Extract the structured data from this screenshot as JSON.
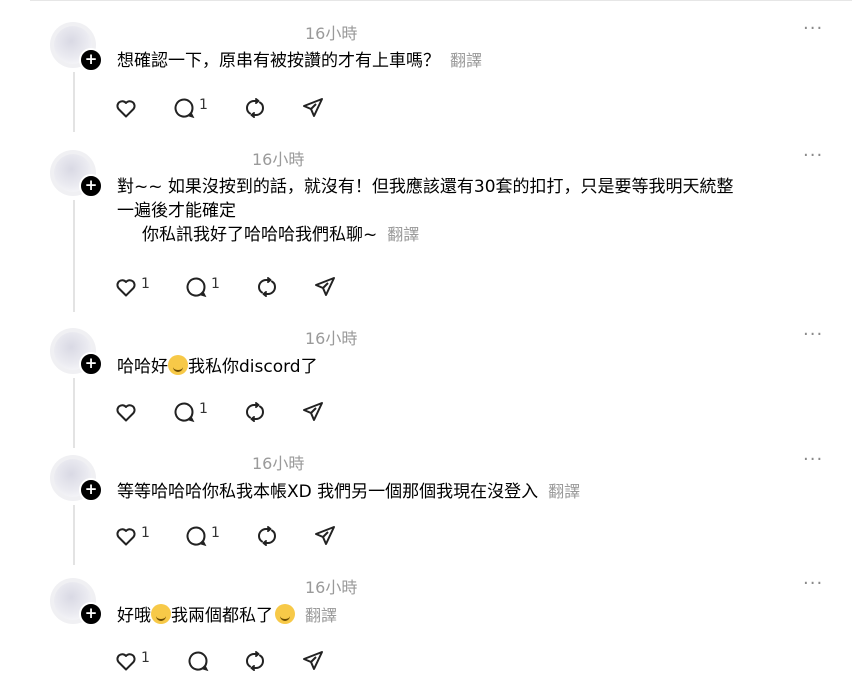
{
  "labels": {
    "translate": "翻譯",
    "more": "···"
  },
  "posts": [
    {
      "time": "16小時",
      "text": "想確認一下，原串有被按讚的才有上車嗎？",
      "has_translate": true,
      "counts": {
        "like": "",
        "reply": "1"
      }
    },
    {
      "time": "16小時",
      "text1": "對~~ 如果沒按到的話，就沒有！但我應該還有30套的扣打，只是要等我明天統整",
      "text2": "一遍後才能確定",
      "text3": "你私訊我好了哈哈哈我們私聊~",
      "has_translate": true,
      "counts": {
        "like": "1",
        "reply": "1"
      }
    },
    {
      "time": "16小時",
      "text_a": "哈哈好",
      "text_b": "我私你discord了",
      "counts": {
        "like": "",
        "reply": "1"
      }
    },
    {
      "time": "16小時",
      "text": "等等哈哈哈你私我本帳XD 我們另一個那個我現在沒登入",
      "has_translate": true,
      "counts": {
        "like": "1",
        "reply": "1"
      }
    },
    {
      "time": "16小時",
      "text_a": "好哦",
      "text_b": "我兩個都私了",
      "has_translate": true,
      "counts": {
        "like": "1",
        "reply": ""
      }
    }
  ],
  "icons": [
    "heart-icon",
    "comment-icon",
    "repost-icon",
    "share-icon",
    "plus-icon",
    "more-icon",
    "laughing-emoji-icon",
    "smile-emoji-icon"
  ],
  "colors": {
    "muted": "#9a9a9a",
    "thread_line": "#e3e3e3"
  }
}
